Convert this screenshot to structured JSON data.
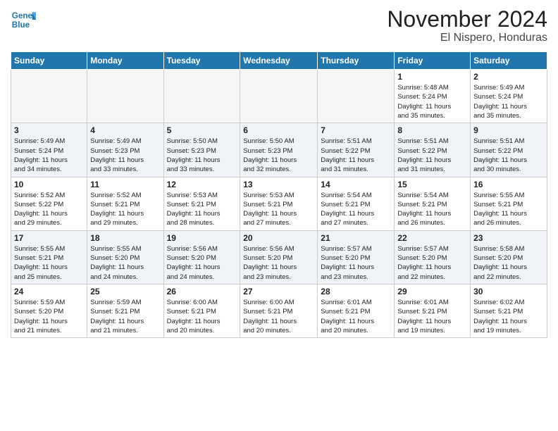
{
  "header": {
    "logo_line1": "General",
    "logo_line2": "Blue",
    "title": "November 2024",
    "subtitle": "El Nispero, Honduras"
  },
  "days_of_week": [
    "Sunday",
    "Monday",
    "Tuesday",
    "Wednesday",
    "Thursday",
    "Friday",
    "Saturday"
  ],
  "weeks": [
    [
      {
        "num": "",
        "info": "",
        "empty": true
      },
      {
        "num": "",
        "info": "",
        "empty": true
      },
      {
        "num": "",
        "info": "",
        "empty": true
      },
      {
        "num": "",
        "info": "",
        "empty": true
      },
      {
        "num": "",
        "info": "",
        "empty": true
      },
      {
        "num": "1",
        "info": "Sunrise: 5:48 AM\nSunset: 5:24 PM\nDaylight: 11 hours\nand 35 minutes."
      },
      {
        "num": "2",
        "info": "Sunrise: 5:49 AM\nSunset: 5:24 PM\nDaylight: 11 hours\nand 35 minutes."
      }
    ],
    [
      {
        "num": "3",
        "info": "Sunrise: 5:49 AM\nSunset: 5:24 PM\nDaylight: 11 hours\nand 34 minutes."
      },
      {
        "num": "4",
        "info": "Sunrise: 5:49 AM\nSunset: 5:23 PM\nDaylight: 11 hours\nand 33 minutes."
      },
      {
        "num": "5",
        "info": "Sunrise: 5:50 AM\nSunset: 5:23 PM\nDaylight: 11 hours\nand 33 minutes."
      },
      {
        "num": "6",
        "info": "Sunrise: 5:50 AM\nSunset: 5:23 PM\nDaylight: 11 hours\nand 32 minutes."
      },
      {
        "num": "7",
        "info": "Sunrise: 5:51 AM\nSunset: 5:22 PM\nDaylight: 11 hours\nand 31 minutes."
      },
      {
        "num": "8",
        "info": "Sunrise: 5:51 AM\nSunset: 5:22 PM\nDaylight: 11 hours\nand 31 minutes."
      },
      {
        "num": "9",
        "info": "Sunrise: 5:51 AM\nSunset: 5:22 PM\nDaylight: 11 hours\nand 30 minutes."
      }
    ],
    [
      {
        "num": "10",
        "info": "Sunrise: 5:52 AM\nSunset: 5:22 PM\nDaylight: 11 hours\nand 29 minutes."
      },
      {
        "num": "11",
        "info": "Sunrise: 5:52 AM\nSunset: 5:21 PM\nDaylight: 11 hours\nand 29 minutes."
      },
      {
        "num": "12",
        "info": "Sunrise: 5:53 AM\nSunset: 5:21 PM\nDaylight: 11 hours\nand 28 minutes."
      },
      {
        "num": "13",
        "info": "Sunrise: 5:53 AM\nSunset: 5:21 PM\nDaylight: 11 hours\nand 27 minutes."
      },
      {
        "num": "14",
        "info": "Sunrise: 5:54 AM\nSunset: 5:21 PM\nDaylight: 11 hours\nand 27 minutes."
      },
      {
        "num": "15",
        "info": "Sunrise: 5:54 AM\nSunset: 5:21 PM\nDaylight: 11 hours\nand 26 minutes."
      },
      {
        "num": "16",
        "info": "Sunrise: 5:55 AM\nSunset: 5:21 PM\nDaylight: 11 hours\nand 26 minutes."
      }
    ],
    [
      {
        "num": "17",
        "info": "Sunrise: 5:55 AM\nSunset: 5:21 PM\nDaylight: 11 hours\nand 25 minutes."
      },
      {
        "num": "18",
        "info": "Sunrise: 5:55 AM\nSunset: 5:20 PM\nDaylight: 11 hours\nand 24 minutes."
      },
      {
        "num": "19",
        "info": "Sunrise: 5:56 AM\nSunset: 5:20 PM\nDaylight: 11 hours\nand 24 minutes."
      },
      {
        "num": "20",
        "info": "Sunrise: 5:56 AM\nSunset: 5:20 PM\nDaylight: 11 hours\nand 23 minutes."
      },
      {
        "num": "21",
        "info": "Sunrise: 5:57 AM\nSunset: 5:20 PM\nDaylight: 11 hours\nand 23 minutes."
      },
      {
        "num": "22",
        "info": "Sunrise: 5:57 AM\nSunset: 5:20 PM\nDaylight: 11 hours\nand 22 minutes."
      },
      {
        "num": "23",
        "info": "Sunrise: 5:58 AM\nSunset: 5:20 PM\nDaylight: 11 hours\nand 22 minutes."
      }
    ],
    [
      {
        "num": "24",
        "info": "Sunrise: 5:59 AM\nSunset: 5:20 PM\nDaylight: 11 hours\nand 21 minutes."
      },
      {
        "num": "25",
        "info": "Sunrise: 5:59 AM\nSunset: 5:21 PM\nDaylight: 11 hours\nand 21 minutes."
      },
      {
        "num": "26",
        "info": "Sunrise: 6:00 AM\nSunset: 5:21 PM\nDaylight: 11 hours\nand 20 minutes."
      },
      {
        "num": "27",
        "info": "Sunrise: 6:00 AM\nSunset: 5:21 PM\nDaylight: 11 hours\nand 20 minutes."
      },
      {
        "num": "28",
        "info": "Sunrise: 6:01 AM\nSunset: 5:21 PM\nDaylight: 11 hours\nand 20 minutes."
      },
      {
        "num": "29",
        "info": "Sunrise: 6:01 AM\nSunset: 5:21 PM\nDaylight: 11 hours\nand 19 minutes."
      },
      {
        "num": "30",
        "info": "Sunrise: 6:02 AM\nSunset: 5:21 PM\nDaylight: 11 hours\nand 19 minutes."
      }
    ]
  ]
}
